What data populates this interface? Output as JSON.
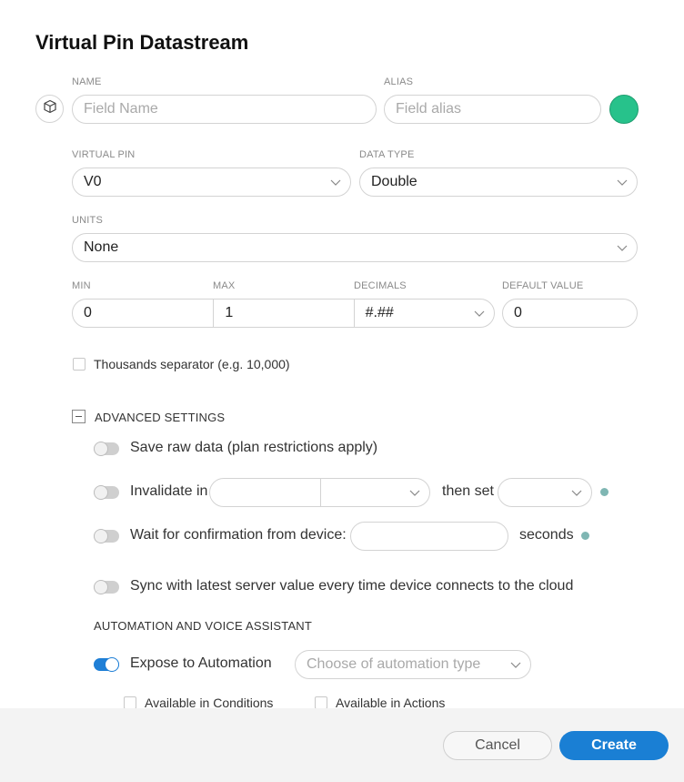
{
  "dialog": {
    "title": "Virtual Pin Datastream"
  },
  "name": {
    "label": "NAME",
    "placeholder": "Field Name"
  },
  "alias": {
    "label": "ALIAS",
    "placeholder": "Field alias"
  },
  "color": {
    "value": "#27c28b"
  },
  "virtual_pin": {
    "label": "VIRTUAL PIN",
    "value": "V0"
  },
  "data_type": {
    "label": "DATA TYPE",
    "value": "Double"
  },
  "units": {
    "label": "UNITS",
    "value": "None"
  },
  "min": {
    "label": "MIN",
    "value": "0"
  },
  "max": {
    "label": "MAX",
    "value": "1"
  },
  "decimals": {
    "label": "DECIMALS",
    "value": "#.##"
  },
  "default_value": {
    "label": "DEFAULT VALUE",
    "value": "0"
  },
  "thousands": {
    "label": "Thousands separator (e.g. 10,000)",
    "checked": false
  },
  "advanced": {
    "title": "ADVANCED SETTINGS",
    "save_raw": {
      "label": "Save raw data (plan restrictions apply)",
      "on": false
    },
    "invalidate": {
      "label": "Invalidate in",
      "then_label": "then set",
      "on": false
    },
    "wait_confirm": {
      "label": "Wait for confirmation from device:",
      "unit": "seconds",
      "on": false
    },
    "sync": {
      "label": "Sync with latest server value every time device connects to the cloud",
      "on": false
    }
  },
  "automation": {
    "title": "AUTOMATION AND VOICE ASSISTANT",
    "expose": {
      "label": "Expose to Automation",
      "on": true
    },
    "type_placeholder": "Choose of automation type",
    "conditions": {
      "label": "Available in Conditions",
      "checked": false
    },
    "actions": {
      "label": "Available in Actions",
      "checked": false
    }
  },
  "footer": {
    "cancel": "Cancel",
    "create": "Create"
  },
  "icons": [
    "cube-icon",
    "chevron-down-icon",
    "info-icon",
    "collapse-icon"
  ]
}
